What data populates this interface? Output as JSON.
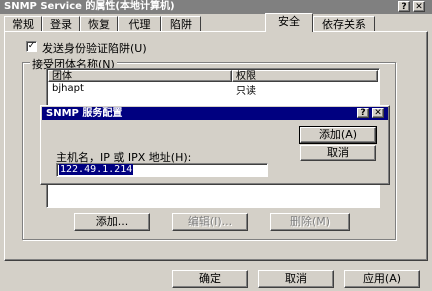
{
  "window": {
    "title": "SNMP Service 的属性(本地计算机)",
    "help_btn": "?",
    "close_btn": "✕"
  },
  "tabs": [
    {
      "label": "常规"
    },
    {
      "label": "登录"
    },
    {
      "label": "恢复"
    },
    {
      "label": "代理"
    },
    {
      "label": "陷阱"
    },
    {
      "label": "安全"
    },
    {
      "label": "依存关系"
    }
  ],
  "security": {
    "send_auth_trap_label": "发送身份验证陷阱(U)",
    "send_auth_trap_checked": true,
    "accepted_communities_label": "接受团体名称(N)",
    "col_community": "团体",
    "col_rights": "权限",
    "rows": [
      {
        "community": "bjhapt",
        "rights": "只读"
      }
    ],
    "add_btn": "添加...",
    "edit_btn": "编辑(I)...",
    "remove_btn": "删除(M)"
  },
  "dialog": {
    "title": "SNMP 服务配置",
    "help_btn": "?",
    "close_btn": "✕",
    "host_label": "主机名，IP 或 IPX 地址(H):",
    "host_value": "122.49.1.214",
    "add_btn": "添加(A)",
    "cancel_btn": "取消"
  },
  "footer": {
    "ok_btn": "确定",
    "cancel_btn": "取消",
    "apply_btn": "应用(A)"
  },
  "colors": {
    "titlebar_inactive": "#808080",
    "titlebar_active": "#000080",
    "face": "#d4d0c8"
  }
}
